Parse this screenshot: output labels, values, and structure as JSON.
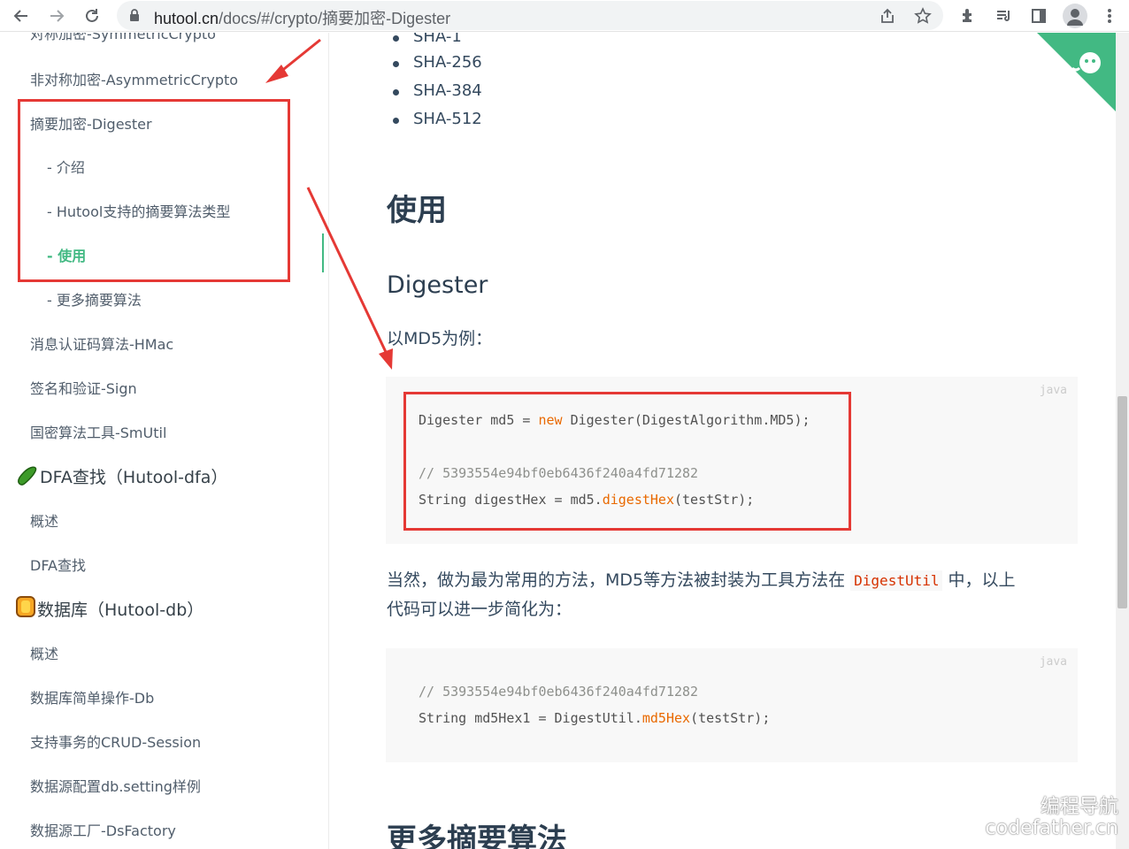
{
  "browser": {
    "url_host": "hutool.cn",
    "url_path": "/docs/#/crypto/摘要加密-Digester"
  },
  "sidebar": {
    "cut_item": "对称加密-SymmetricCrypto",
    "items": [
      {
        "label": "非对称加密-AsymmetricCrypto"
      },
      {
        "label": "摘要加密-Digester"
      },
      {
        "label": "- 介绍"
      },
      {
        "label": "- Hutool支持的摘要算法类型"
      },
      {
        "label": "- 使用"
      },
      {
        "label": "- 更多摘要算法"
      },
      {
        "label": "消息认证码算法-HMac"
      },
      {
        "label": "签名和验证-Sign"
      },
      {
        "label": "国密算法工具-SmUtil"
      },
      {
        "label": "DFA查找（Hutool-dfa）"
      },
      {
        "label": "概述"
      },
      {
        "label": "DFA查找"
      },
      {
        "label": "数据库（Hutool-db）"
      },
      {
        "label": "概述"
      },
      {
        "label": "数据库简单操作-Db"
      },
      {
        "label": "支持事务的CRUD-Session"
      },
      {
        "label": "数据源配置db.setting样例"
      },
      {
        "label": "数据源工厂-DsFactory"
      }
    ]
  },
  "content": {
    "list_cut": "SHA-1",
    "list_items": [
      "SHA-256",
      "SHA-384",
      "SHA-512"
    ],
    "heading_use": "使用",
    "heading_digester": "Digester",
    "intro_text": "以MD5为例：",
    "code1": {
      "lang": "java",
      "line1_a": "Digester md5 = ",
      "line1_kw": "new",
      "line1_b": " Digester(DigestAlgorithm.MD5);",
      "line2": "// 5393554e94bf0eb6436f240a4fd71282",
      "line3_a": "String digestHex = md5.",
      "line3_fn": "digestHex",
      "line3_b": "(testStr);"
    },
    "para2_a": "当然，做为最为常用的方法，MD5等方法被封装为工具方法在 ",
    "para2_code": "DigestUtil",
    "para2_b": " 中，以上",
    "para2_line2": "代码可以进一步简化为：",
    "code2": {
      "lang": "java",
      "line1": "// 5393554e94bf0eb6436f240a4fd71282",
      "line2_a": "String md5Hex1 = DigestUtil.",
      "line2_fn": "md5Hex",
      "line2_b": "(testStr);"
    },
    "heading_more": "更多摘要算法"
  },
  "watermark": {
    "line1": "编程导航",
    "line2": "codefather.cn"
  },
  "colors": {
    "accent": "#42b983",
    "annotation": "#e53935"
  }
}
